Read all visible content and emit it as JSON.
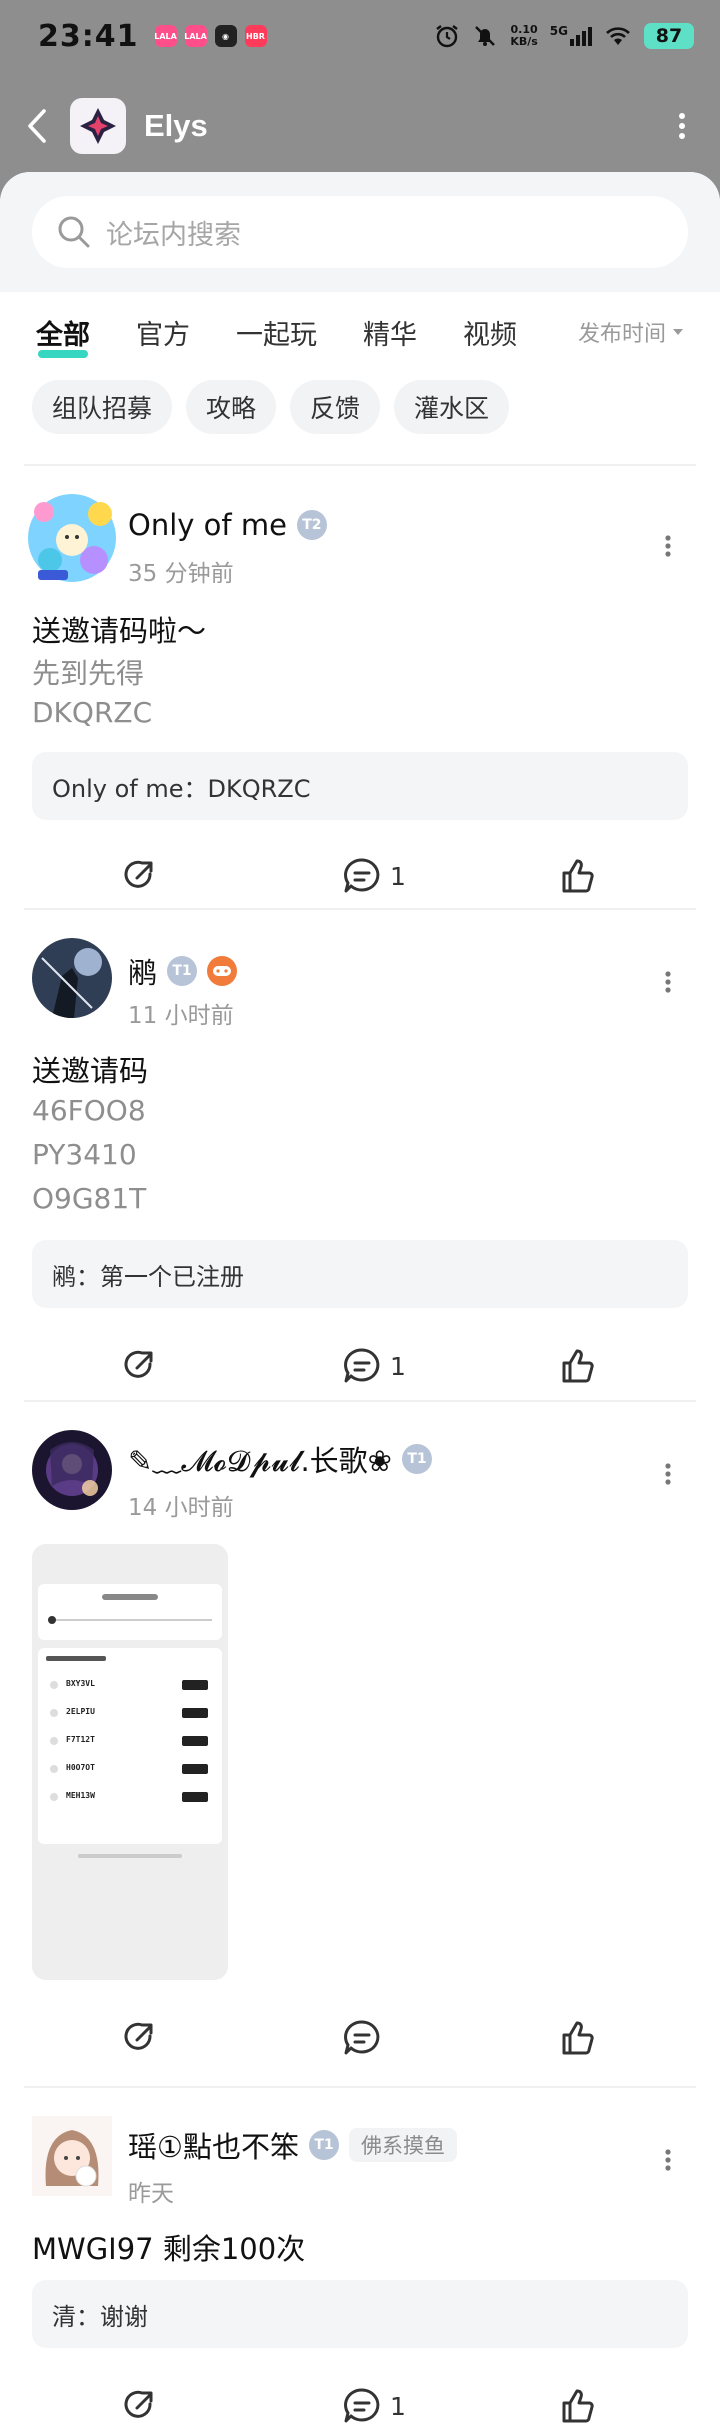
{
  "status": {
    "time": "23:41",
    "apps": [
      {
        "icon": "lala-icon",
        "label": "LALA",
        "color": "#ff4f8b"
      },
      {
        "icon": "lala-icon",
        "label": "LALA",
        "color": "#ff4f8b"
      },
      {
        "icon": "circle-app-icon",
        "label": "",
        "color": "#222222"
      },
      {
        "icon": "red-app-icon",
        "label": "HBR",
        "color": "#ff3b5c"
      }
    ],
    "net_speed_value": "0.10",
    "net_speed_unit": "KB/s",
    "signal_label": "5G",
    "battery": "87"
  },
  "header": {
    "title": "Elys"
  },
  "search": {
    "placeholder": "论坛内搜索"
  },
  "tabs": [
    {
      "label": "全部",
      "active": true
    },
    {
      "label": "官方"
    },
    {
      "label": "一起玩"
    },
    {
      "label": "精华"
    },
    {
      "label": "视频"
    }
  ],
  "sort_label": "发布时间",
  "chips": [
    "组队招募",
    "攻略",
    "反馈",
    "灌水区"
  ],
  "posts": [
    {
      "author": "Only of me",
      "level": "T2",
      "time": "35 分钟前",
      "title": "送邀请码啦～",
      "lines": [
        "先到先得",
        "DKQRZC"
      ],
      "comment": "Only of me：DKQRZC",
      "comment_count": "1"
    },
    {
      "author": "鹇",
      "level": "T1",
      "time": "11 小时前",
      "title": "送邀请码",
      "lines": [
        "46FOO8",
        "PY3410",
        "O9G81T"
      ],
      "comment": "鹇：第一个已注册",
      "comment_count": "1"
    },
    {
      "author": "✎﹏𝓜𝓸𝓓𝓹𝓾𝓵.长歌❀",
      "level": "T1",
      "time": "14 小时前",
      "image_codes": [
        "BXY3VL",
        "2ELPIU",
        "F7T12T",
        "H0O7OT",
        "MEH13W"
      ],
      "comment_count": ""
    },
    {
      "author": "瑶①點也不笨",
      "level": "T1",
      "badge": "佛系摸鱼",
      "time": "昨天",
      "title": "MWGI97 剩余100次",
      "comment": "清：谢谢",
      "comment_count": "1"
    }
  ]
}
